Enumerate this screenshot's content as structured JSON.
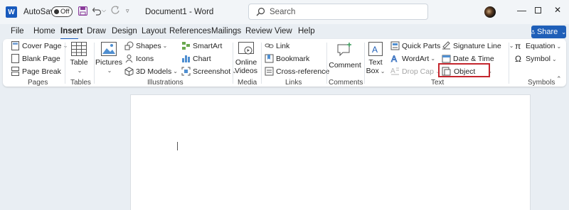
{
  "titlebar": {
    "logo": "W",
    "autosave_label": "AutoSave",
    "autosave_state": "Off",
    "document_title": "Document1 - Word",
    "search_placeholder": "Search"
  },
  "tabs": [
    "File",
    "Home",
    "Insert",
    "Draw",
    "Design",
    "Layout",
    "References",
    "Mailings",
    "Review",
    "View",
    "Help"
  ],
  "active_tab": "Insert",
  "share_label": "Share",
  "ribbon": {
    "pages": {
      "group_label": "Pages",
      "cover_page": "Cover Page",
      "blank_page": "Blank Page",
      "page_break": "Page Break"
    },
    "tables": {
      "group_label": "Tables",
      "table": "Table"
    },
    "illustrations": {
      "group_label": "Illustrations",
      "pictures": "Pictures",
      "shapes": "Shapes",
      "icons": "Icons",
      "models_3d": "3D Models",
      "smartart": "SmartArt",
      "chart": "Chart",
      "screenshot": "Screenshot"
    },
    "media": {
      "group_label": "Media",
      "online_line1": "Online",
      "online_line2": "Videos"
    },
    "links": {
      "group_label": "Links",
      "link": "Link",
      "bookmark": "Bookmark",
      "cross_reference": "Cross-reference"
    },
    "comments": {
      "group_label": "Comments",
      "comment": "Comment"
    },
    "text": {
      "group_label": "Text",
      "textbox_line1": "Text",
      "textbox_line2": "Box",
      "quick_parts": "Quick Parts",
      "wordart": "WordArt",
      "drop_cap": "Drop Cap",
      "signature_line": "Signature Line",
      "date_time": "Date & Time",
      "object": "Object"
    },
    "symbols": {
      "group_label": "Symbols",
      "equation": "Equation",
      "symbol": "Symbol"
    }
  },
  "colors": {
    "accent": "#185abd",
    "share": "#1f5fb8",
    "highlight": "#c4262e",
    "background": "#e9eef3"
  }
}
